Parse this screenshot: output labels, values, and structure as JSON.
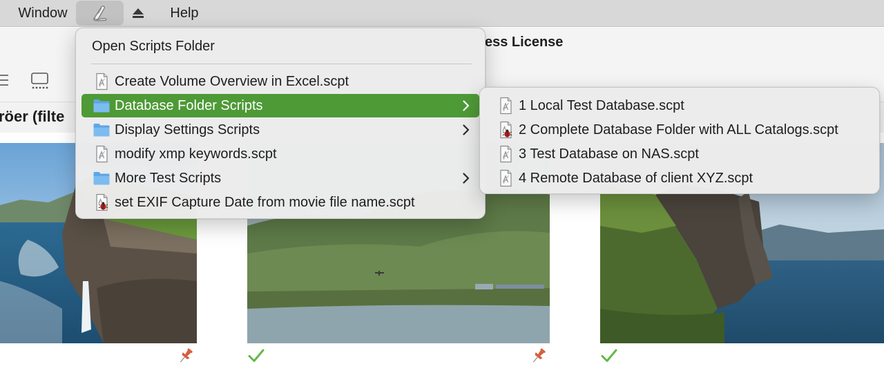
{
  "menubar": {
    "items": [
      {
        "label": "Window"
      },
      {
        "icon": "script-menu-icon"
      },
      {
        "icon": "eject-icon"
      },
      {
        "label": "Help"
      }
    ]
  },
  "window": {
    "title": "ess License",
    "section_title": "röer  (filte"
  },
  "script_menu": {
    "open_folder_label": "Open Scripts Folder",
    "items": [
      {
        "label": "Create Volume Overview in Excel.scpt",
        "icon": "script-file-icon"
      },
      {
        "label": "Database Folder Scripts",
        "icon": "folder-icon",
        "submenu": true,
        "highlighted": true
      },
      {
        "label": "Display Settings Scripts",
        "icon": "folder-icon",
        "submenu": true
      },
      {
        "label": "modify xmp keywords.scpt",
        "icon": "script-file-icon"
      },
      {
        "label": "More Test Scripts",
        "icon": "folder-icon",
        "submenu": true
      },
      {
        "label": "set EXIF Capture Date from movie file name.scpt",
        "icon": "script-file-bug-icon"
      }
    ]
  },
  "submenu": {
    "items": [
      {
        "label": "1 Local Test Database.scpt",
        "icon": "script-file-icon"
      },
      {
        "label": "2 Complete Database Folder with ALL Catalogs.scpt",
        "icon": "script-file-bug-icon"
      },
      {
        "label": "3 Test Database on NAS.scpt",
        "icon": "script-file-icon"
      },
      {
        "label": "4 Remote Database of client XYZ.scpt",
        "icon": "script-file-icon"
      }
    ]
  },
  "colors": {
    "highlight": "#4e9a36",
    "checkmark": "#62b84a",
    "pin": "#d85c3a",
    "folder": "#5fa8e8"
  }
}
